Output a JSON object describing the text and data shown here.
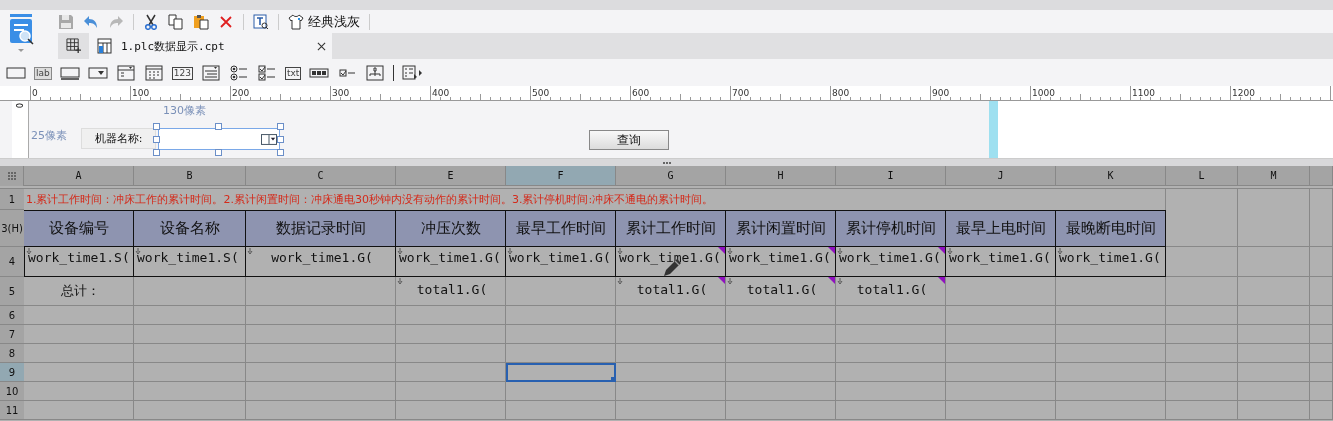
{
  "toolbar": {
    "theme_button": "经典浅灰"
  },
  "tab": {
    "label": "1.plc数据显示.cpt",
    "selected": true
  },
  "widgets": [
    {
      "kind": "frame"
    },
    {
      "kind": "label",
      "glyph": "lab"
    },
    {
      "kind": "textfield"
    },
    {
      "kind": "dropdown"
    },
    {
      "kind": "combo"
    },
    {
      "kind": "calendar"
    },
    {
      "kind": "number",
      "glyph": "123"
    },
    {
      "kind": "textarea"
    },
    {
      "kind": "radio"
    },
    {
      "kind": "checkbox"
    },
    {
      "kind": "text",
      "glyph": "txt"
    },
    {
      "kind": "password"
    },
    {
      "kind": "check"
    },
    {
      "kind": "tree"
    },
    {
      "kind": "more"
    }
  ],
  "ruler": {
    "ticks": [
      "0",
      "100",
      "200",
      "300",
      "400",
      "500",
      "600",
      "700",
      "800",
      "900",
      "1000",
      "1100",
      "1200"
    ],
    "vertical_label": "0"
  },
  "params": {
    "width_hint": "130像素",
    "height_hint": "25像素",
    "label": "机器名称:",
    "button": "查询"
  },
  "sheet": {
    "columns": [
      {
        "label": "A",
        "selected": false
      },
      {
        "label": "B",
        "selected": false
      },
      {
        "label": "C",
        "selected": false
      },
      {
        "label": "E",
        "selected": false
      },
      {
        "label": "F",
        "selected": true
      },
      {
        "label": "G",
        "selected": false
      },
      {
        "label": "H",
        "selected": false
      },
      {
        "label": "I",
        "selected": false
      },
      {
        "label": "J",
        "selected": false
      },
      {
        "label": "K",
        "selected": false
      },
      {
        "label": "L",
        "selected": false
      },
      {
        "label": "M",
        "selected": false
      }
    ],
    "rows": [
      {
        "label": "1",
        "selected": false,
        "kind": "note",
        "cells": [
          {
            "text": "1.累计工作时间：冲床工作的累计时间。2.累计闲置时间：冲床通电30秒钟内没有动作的累计时间。3.累计停机时间:冲床不通电的累计时间。"
          }
        ]
      },
      {
        "label": "3(H)",
        "selected": false,
        "kind": "header",
        "cells": [
          {
            "text": "设备编号"
          },
          {
            "text": "设备名称"
          },
          {
            "text": "数据记录时间"
          },
          {
            "text": "冲压次数"
          },
          {
            "text": "最早工作时间"
          },
          {
            "text": "累计工作时间"
          },
          {
            "text": "累计闲置时间"
          },
          {
            "text": "累计停机时间"
          },
          {
            "text": "最早上电时间"
          },
          {
            "text": "最晚断电时间"
          }
        ]
      },
      {
        "label": "4",
        "selected": false,
        "kind": "data",
        "cells": [
          {
            "text": "work_time1.S(",
            "expand": true,
            "marker": false
          },
          {
            "text": "work_time1.S(",
            "expand": true,
            "marker": false
          },
          {
            "text": "work_time1.G(",
            "expand": true,
            "marker": false
          },
          {
            "text": "work_time1.G(",
            "expand": true,
            "marker": false
          },
          {
            "text": "work_time1.G(",
            "expand": true,
            "marker": false
          },
          {
            "text": "work_time1.G(",
            "expand": true,
            "marker": true
          },
          {
            "text": "work_time1.G(",
            "expand": true,
            "marker": true
          },
          {
            "text": "work_time1.G(",
            "expand": true,
            "marker": true
          },
          {
            "text": "work_time1.G(",
            "expand": true,
            "marker": false
          },
          {
            "text": "work_time1.G(",
            "expand": true,
            "marker": false
          }
        ]
      },
      {
        "label": "5",
        "selected": false,
        "kind": "total",
        "cells": [
          {
            "text": "总计："
          },
          {},
          {},
          {
            "text": "total1.G(",
            "expand": true,
            "marker": false
          },
          {},
          {
            "text": "total1.G(",
            "expand": true,
            "marker": true
          },
          {
            "text": "total1.G(",
            "expand": true,
            "marker": true
          },
          {
            "text": "total1.G(",
            "expand": true,
            "marker": true
          }
        ]
      },
      {
        "label": "6",
        "selected": false,
        "kind": "empty"
      },
      {
        "label": "7",
        "selected": false,
        "kind": "empty"
      },
      {
        "label": "8",
        "selected": false,
        "kind": "empty"
      },
      {
        "label": "9",
        "selected": true,
        "kind": "empty"
      },
      {
        "label": "10",
        "selected": false,
        "kind": "empty"
      },
      {
        "label": "11",
        "selected": false,
        "kind": "empty"
      }
    ]
  }
}
